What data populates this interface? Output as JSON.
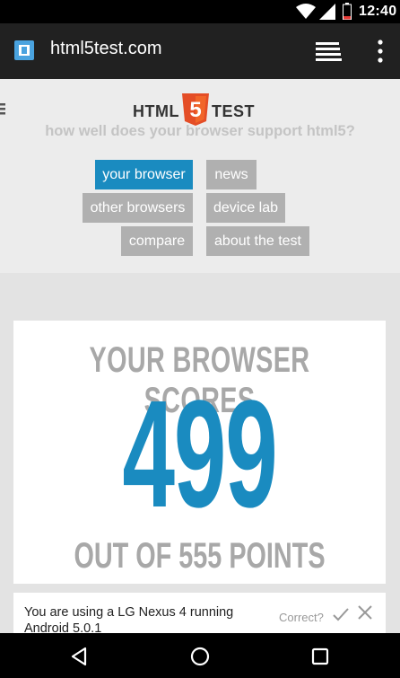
{
  "status_bar": {
    "time": "12:40",
    "icons": [
      "wifi-icon",
      "signal-icon",
      "battery-icon"
    ]
  },
  "toolbar": {
    "url": "html5test.com",
    "icons": [
      "site-favicon",
      "tab-switcher-icon",
      "overflow-menu-icon"
    ]
  },
  "header": {
    "logo_left": "HTML",
    "logo_shield": "5",
    "logo_right": "TEST",
    "tagline": "how well does your browser support html5?"
  },
  "nav": {
    "your_browser": "your browser",
    "news": "news",
    "other_browsers": "other browsers",
    "device_lab": "device lab",
    "compare": "compare",
    "about": "about the test"
  },
  "score": {
    "heading": "YOUR BROWSER SCORES",
    "value": "499",
    "footer": "OUT OF 555 POINTS"
  },
  "user_agent": {
    "text": "You are using a LG Nexus 4 running Android 5.0.1",
    "correct_label": "Correct?"
  },
  "colors": {
    "accent": "#1a8bc0",
    "logo_orange": "#e44d26",
    "muted": "#a8a8a8"
  }
}
